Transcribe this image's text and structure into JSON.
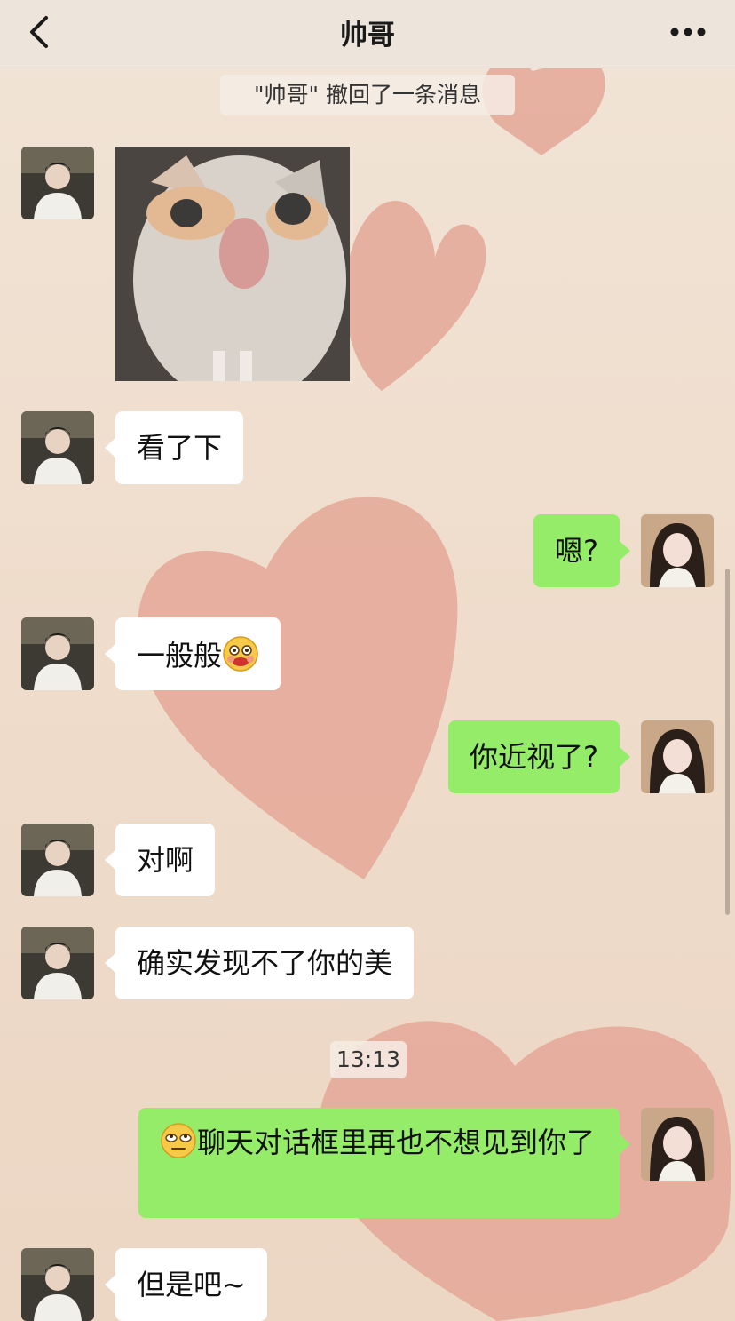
{
  "navbar": {
    "title": "帅哥",
    "back_icon": "chevron-left-icon",
    "more_icon": "ellipsis-icon"
  },
  "system_notice": "\"帅哥\" 撤回了一条消息",
  "time_stamp": "13:13",
  "colors": {
    "outgoing_bubble": "#95ec69",
    "incoming_bubble": "#ffffff",
    "background": "#efdccb",
    "heart": "#e3a493"
  },
  "messages": [
    {
      "side": "in",
      "type": "image",
      "content": "cat-photo"
    },
    {
      "side": "in",
      "type": "text",
      "text": "看了下"
    },
    {
      "side": "out",
      "type": "text",
      "text": "嗯?"
    },
    {
      "side": "in",
      "type": "text",
      "text": "一般般",
      "emoji": "tongue-out-emoji"
    },
    {
      "side": "out",
      "type": "text",
      "text": "你近视了?"
    },
    {
      "side": "in",
      "type": "text",
      "text": "对啊"
    },
    {
      "side": "in",
      "type": "text",
      "text": "确实发现不了你的美"
    },
    {
      "side": "out",
      "type": "text",
      "text": "聊天对话框里再也不想见到你了",
      "emoji": "eye-roll-emoji"
    },
    {
      "side": "in",
      "type": "text",
      "text": "但是吧~"
    }
  ]
}
